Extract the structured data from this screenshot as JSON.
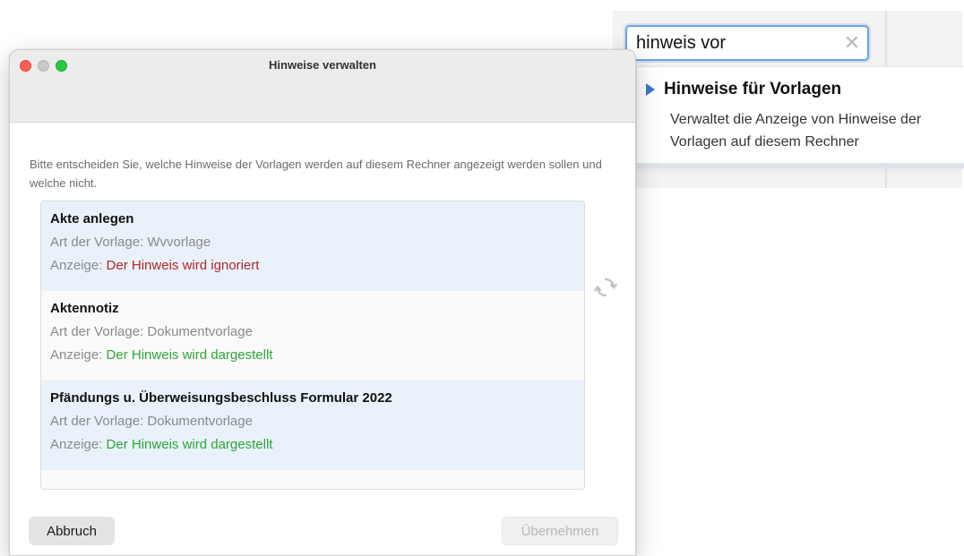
{
  "search": {
    "value": "hinweis vor",
    "clear_glyph": "✕"
  },
  "suggestion": {
    "title": "Hinweise für Vorlagen",
    "description": "Verwaltet die Anzeige von Hinweise der Vorlagen auf diesem Rechner"
  },
  "dialog": {
    "title": "Hinweise verwalten",
    "intro": "Bitte entscheiden Sie, welche Hinweise der Vorlagen werden auf diesem Rechner angezeigt werden sollen und welche nicht.",
    "items": [
      {
        "title": "Akte anlegen",
        "type_label": "Art der Vorlage: Wvvorlage",
        "display_prefix": "Anzeige: ",
        "display_status": "Der Hinweis wird ignoriert",
        "status_color": "#b3262d"
      },
      {
        "title": "Aktennotiz",
        "type_label": "Art der Vorlage: Dokumentvorlage",
        "display_prefix": "Anzeige: ",
        "display_status": "Der Hinweis wird dargestellt",
        "status_color": "#2ea43a"
      },
      {
        "title": "Pfändungs u. Überweisungsbeschluss Formular 2022",
        "type_label": "Art der Vorlage: Dokumentvorlage",
        "display_prefix": "Anzeige: ",
        "display_status": "Der Hinweis wird dargestellt",
        "status_color": "#2ea43a"
      }
    ],
    "refresh_icon": "refresh-icon",
    "buttons": {
      "cancel": "Abbruch",
      "apply": "Übernehmen"
    }
  },
  "colors": {
    "accent": "#3a78c6",
    "focus_ring": "#6aa2e6",
    "selected_row": "#e9f2fa"
  }
}
